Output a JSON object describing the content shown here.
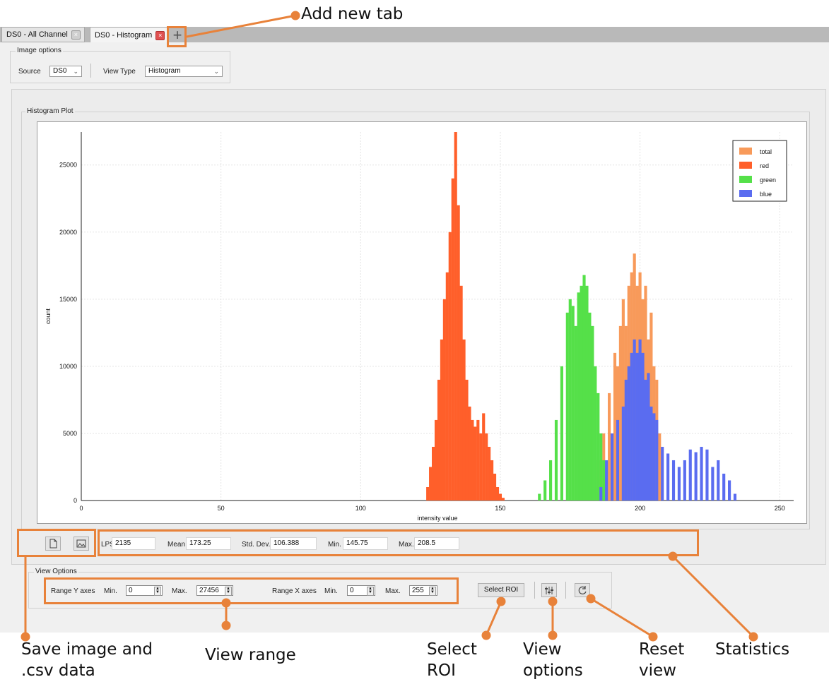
{
  "callouts": {
    "add_new_tab": "Add new tab",
    "save_image": "Save image and\n.csv data",
    "view_range": "View range",
    "select_roi": "Select\nROI",
    "view_options": "View\noptions",
    "reset_view": "Reset\nview",
    "statistics": "Statistics"
  },
  "tabs": [
    {
      "label": "DS0 - All Channel",
      "close": "×"
    },
    {
      "label": "DS0 - Histogram",
      "close": "×"
    }
  ],
  "add_tab_icon": "+",
  "image_options": {
    "title": "Image options",
    "source_label": "Source",
    "source_value": "DS0",
    "view_type_label": "View Type",
    "view_type_value": "Histogram"
  },
  "plot_group": {
    "title": "Histogram Plot"
  },
  "stats": {
    "lps_label": "LPS",
    "lps_value": "2135",
    "mean_label": "Mean",
    "mean_value": "173.25",
    "std_label": "Std. Dev.",
    "std_value": "106.388",
    "min_label": "Min.",
    "min_value": "145.75",
    "max_label": "Max.",
    "max_value": "208.5"
  },
  "view_options": {
    "title": "View Options",
    "range_y_label": "Range Y axes",
    "range_y_min_label": "Min.",
    "range_y_min": "0",
    "range_y_max_label": "Max.",
    "range_y_max": "27456",
    "range_x_label": "Range X axes",
    "range_x_min_label": "Min.",
    "range_x_min": "0",
    "range_x_max_label": "Max.",
    "range_x_max": "255",
    "select_roi_label": "Select ROI"
  },
  "icons": {
    "save_csv": "file-icon",
    "save_image": "image-icon",
    "view_options": "sliders-icon",
    "reset_view": "refresh-icon"
  },
  "colors": {
    "callout": "#e8823a",
    "total": "#f89a5a",
    "red": "#ff5f2a",
    "green": "#55e049",
    "blue": "#5a6cf0"
  },
  "chart_data": {
    "type": "bar",
    "title": "",
    "xlabel": "intensity value",
    "ylabel": "count",
    "xlim": [
      0,
      255
    ],
    "ylim": [
      0,
      27456
    ],
    "xticks": [
      0,
      50,
      100,
      150,
      200,
      250
    ],
    "yticks": [
      0,
      5000,
      10000,
      15000,
      20000,
      25000
    ],
    "legend_position": "top-right",
    "series": [
      {
        "name": "total",
        "color": "#f89a5a",
        "points": [
          [
            185,
            3000
          ],
          [
            187,
            5000
          ],
          [
            189,
            8000
          ],
          [
            191,
            11000
          ],
          [
            192,
            10000
          ],
          [
            193,
            13000
          ],
          [
            194,
            15000
          ],
          [
            195,
            13000
          ],
          [
            196,
            16000
          ],
          [
            197,
            17000
          ],
          [
            198,
            18400
          ],
          [
            199,
            16000
          ],
          [
            200,
            17000
          ],
          [
            201,
            15000
          ],
          [
            202,
            16000
          ],
          [
            203,
            12000
          ],
          [
            204,
            14000
          ],
          [
            205,
            10000
          ],
          [
            206,
            9000
          ],
          [
            207,
            5000
          ]
        ]
      },
      {
        "name": "red",
        "color": "#ff5f2a",
        "points": [
          [
            124,
            1000
          ],
          [
            125,
            2500
          ],
          [
            126,
            4000
          ],
          [
            127,
            6000
          ],
          [
            128,
            9000
          ],
          [
            129,
            12000
          ],
          [
            130,
            15000
          ],
          [
            131,
            17000
          ],
          [
            132,
            20000
          ],
          [
            133,
            24000
          ],
          [
            134,
            27456
          ],
          [
            135,
            22000
          ],
          [
            136,
            16000
          ],
          [
            137,
            12000
          ],
          [
            138,
            9000
          ],
          [
            139,
            7000
          ],
          [
            140,
            6000
          ],
          [
            141,
            5500
          ],
          [
            142,
            6000
          ],
          [
            143,
            5000
          ],
          [
            144,
            6500
          ],
          [
            145,
            5000
          ],
          [
            146,
            4000
          ],
          [
            147,
            3000
          ],
          [
            148,
            2000
          ],
          [
            149,
            1000
          ],
          [
            150,
            500
          ],
          [
            151,
            200
          ]
        ]
      },
      {
        "name": "green",
        "color": "#55e049",
        "points": [
          [
            164,
            500
          ],
          [
            166,
            1500
          ],
          [
            168,
            3000
          ],
          [
            170,
            6000
          ],
          [
            172,
            10000
          ],
          [
            174,
            14000
          ],
          [
            175,
            15000
          ],
          [
            176,
            14500
          ],
          [
            177,
            13000
          ],
          [
            178,
            15500
          ],
          [
            179,
            16000
          ],
          [
            180,
            16800
          ],
          [
            181,
            16000
          ],
          [
            182,
            14000
          ],
          [
            183,
            13000
          ],
          [
            184,
            10000
          ],
          [
            185,
            8000
          ],
          [
            186,
            5000
          ],
          [
            187,
            3000
          ]
        ]
      },
      {
        "name": "blue",
        "color": "#5a6cf0",
        "points": [
          [
            186,
            1000
          ],
          [
            188,
            3000
          ],
          [
            190,
            5000
          ],
          [
            192,
            6000
          ],
          [
            194,
            7000
          ],
          [
            195,
            9000
          ],
          [
            196,
            10000
          ],
          [
            197,
            11000
          ],
          [
            198,
            12000
          ],
          [
            199,
            11000
          ],
          [
            200,
            12000
          ],
          [
            201,
            11000
          ],
          [
            202,
            9000
          ],
          [
            203,
            9500
          ],
          [
            204,
            7000
          ],
          [
            205,
            6500
          ],
          [
            206,
            6000
          ],
          [
            208,
            4000
          ],
          [
            210,
            3500
          ],
          [
            212,
            3000
          ],
          [
            214,
            2500
          ],
          [
            216,
            3000
          ],
          [
            218,
            3800
          ],
          [
            220,
            3600
          ],
          [
            222,
            4000
          ],
          [
            224,
            3800
          ],
          [
            226,
            2500
          ],
          [
            228,
            3000
          ],
          [
            230,
            2000
          ],
          [
            232,
            1500
          ],
          [
            234,
            500
          ]
        ]
      }
    ]
  }
}
